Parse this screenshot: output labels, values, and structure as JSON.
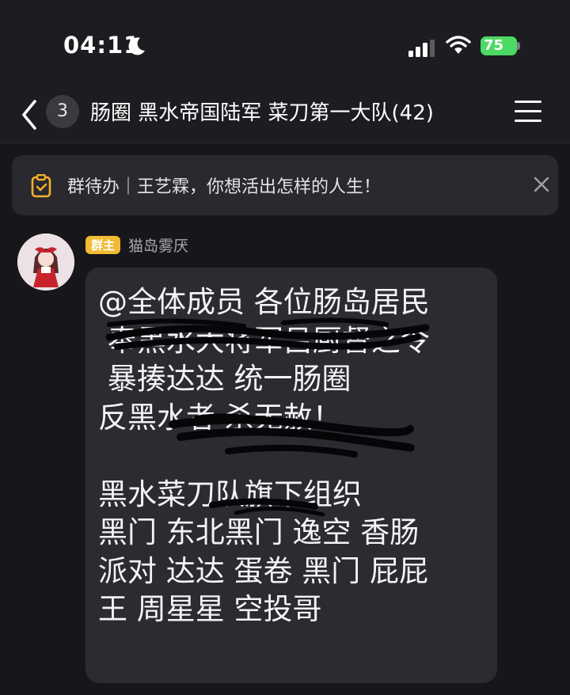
{
  "status_bar": {
    "time": "04:11",
    "battery_level": "75",
    "icons": [
      "moon-icon",
      "signal-icon",
      "wifi-icon",
      "battery-icon"
    ]
  },
  "nav": {
    "unread_count": "3",
    "title": "肠圈 黑水帝国陆军 菜刀第一大队(42)",
    "icons": [
      "back-chevron-icon",
      "menu-icon"
    ]
  },
  "todo_banner": {
    "text": "群待办｜王艺霖，你想活出怎样的人生！",
    "icons": [
      "todo-clipboard-icon",
      "close-icon"
    ]
  },
  "message": {
    "role_badge": "群主",
    "sender": "猫岛雾厌",
    "lines": [
      "@全体成员 各位肠岛居民",
      " 奉黑水大将军吕厨督之令",
      " 暴揍达达 统一肠圈",
      "反黑水者 杀无赦！",
      "",
      "黑水菜刀队旗下组织",
      "黑门 东北黑门 逸空 香肠",
      "派对 达达 蛋卷 黑门 屁屁",
      "王 周星星 空投哥"
    ]
  },
  "colors": {
    "background": "#17171b",
    "bubble": "#2b2b31",
    "banner": "#29292f",
    "role_badge": "#f1ba32",
    "battery": "#4cd964",
    "todo_icon": "#f3b12b"
  }
}
